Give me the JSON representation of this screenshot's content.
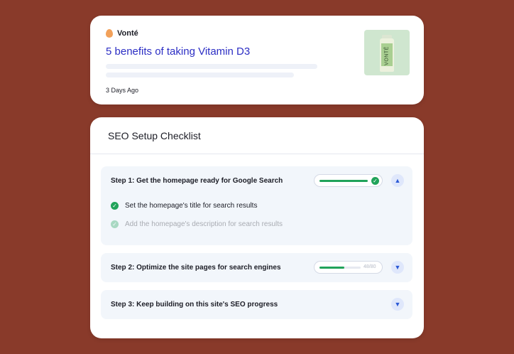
{
  "preview": {
    "brand": "Vonté",
    "title": "5 benefits of taking Vitamin D3",
    "date": "3 Days Ago",
    "thumbnail_label": "VONTÉ"
  },
  "checklist": {
    "title": "SEO Setup Checklist",
    "steps": [
      {
        "title": "Step 1:  Get the homepage ready for Google Search",
        "progress": 1.0,
        "completed": true,
        "expanded": true,
        "items": [
          "Set the homepage's title for search results",
          "Add the homepage's description for search results"
        ]
      },
      {
        "title": "Step 2:  Optimize the site pages for search engines",
        "progress": 0.6,
        "count": "48/80",
        "expanded": false
      },
      {
        "title": "Step 3:  Keep building on this site's SEO progress",
        "expanded": false
      }
    ]
  },
  "colors": {
    "background": "#893a2a",
    "link": "#2c2ec4",
    "success": "#21a35a",
    "accent": "#2c5ad6"
  },
  "icons": [
    "brand-logo-icon",
    "check-circle-icon",
    "chevron-up-icon",
    "chevron-down-icon"
  ]
}
